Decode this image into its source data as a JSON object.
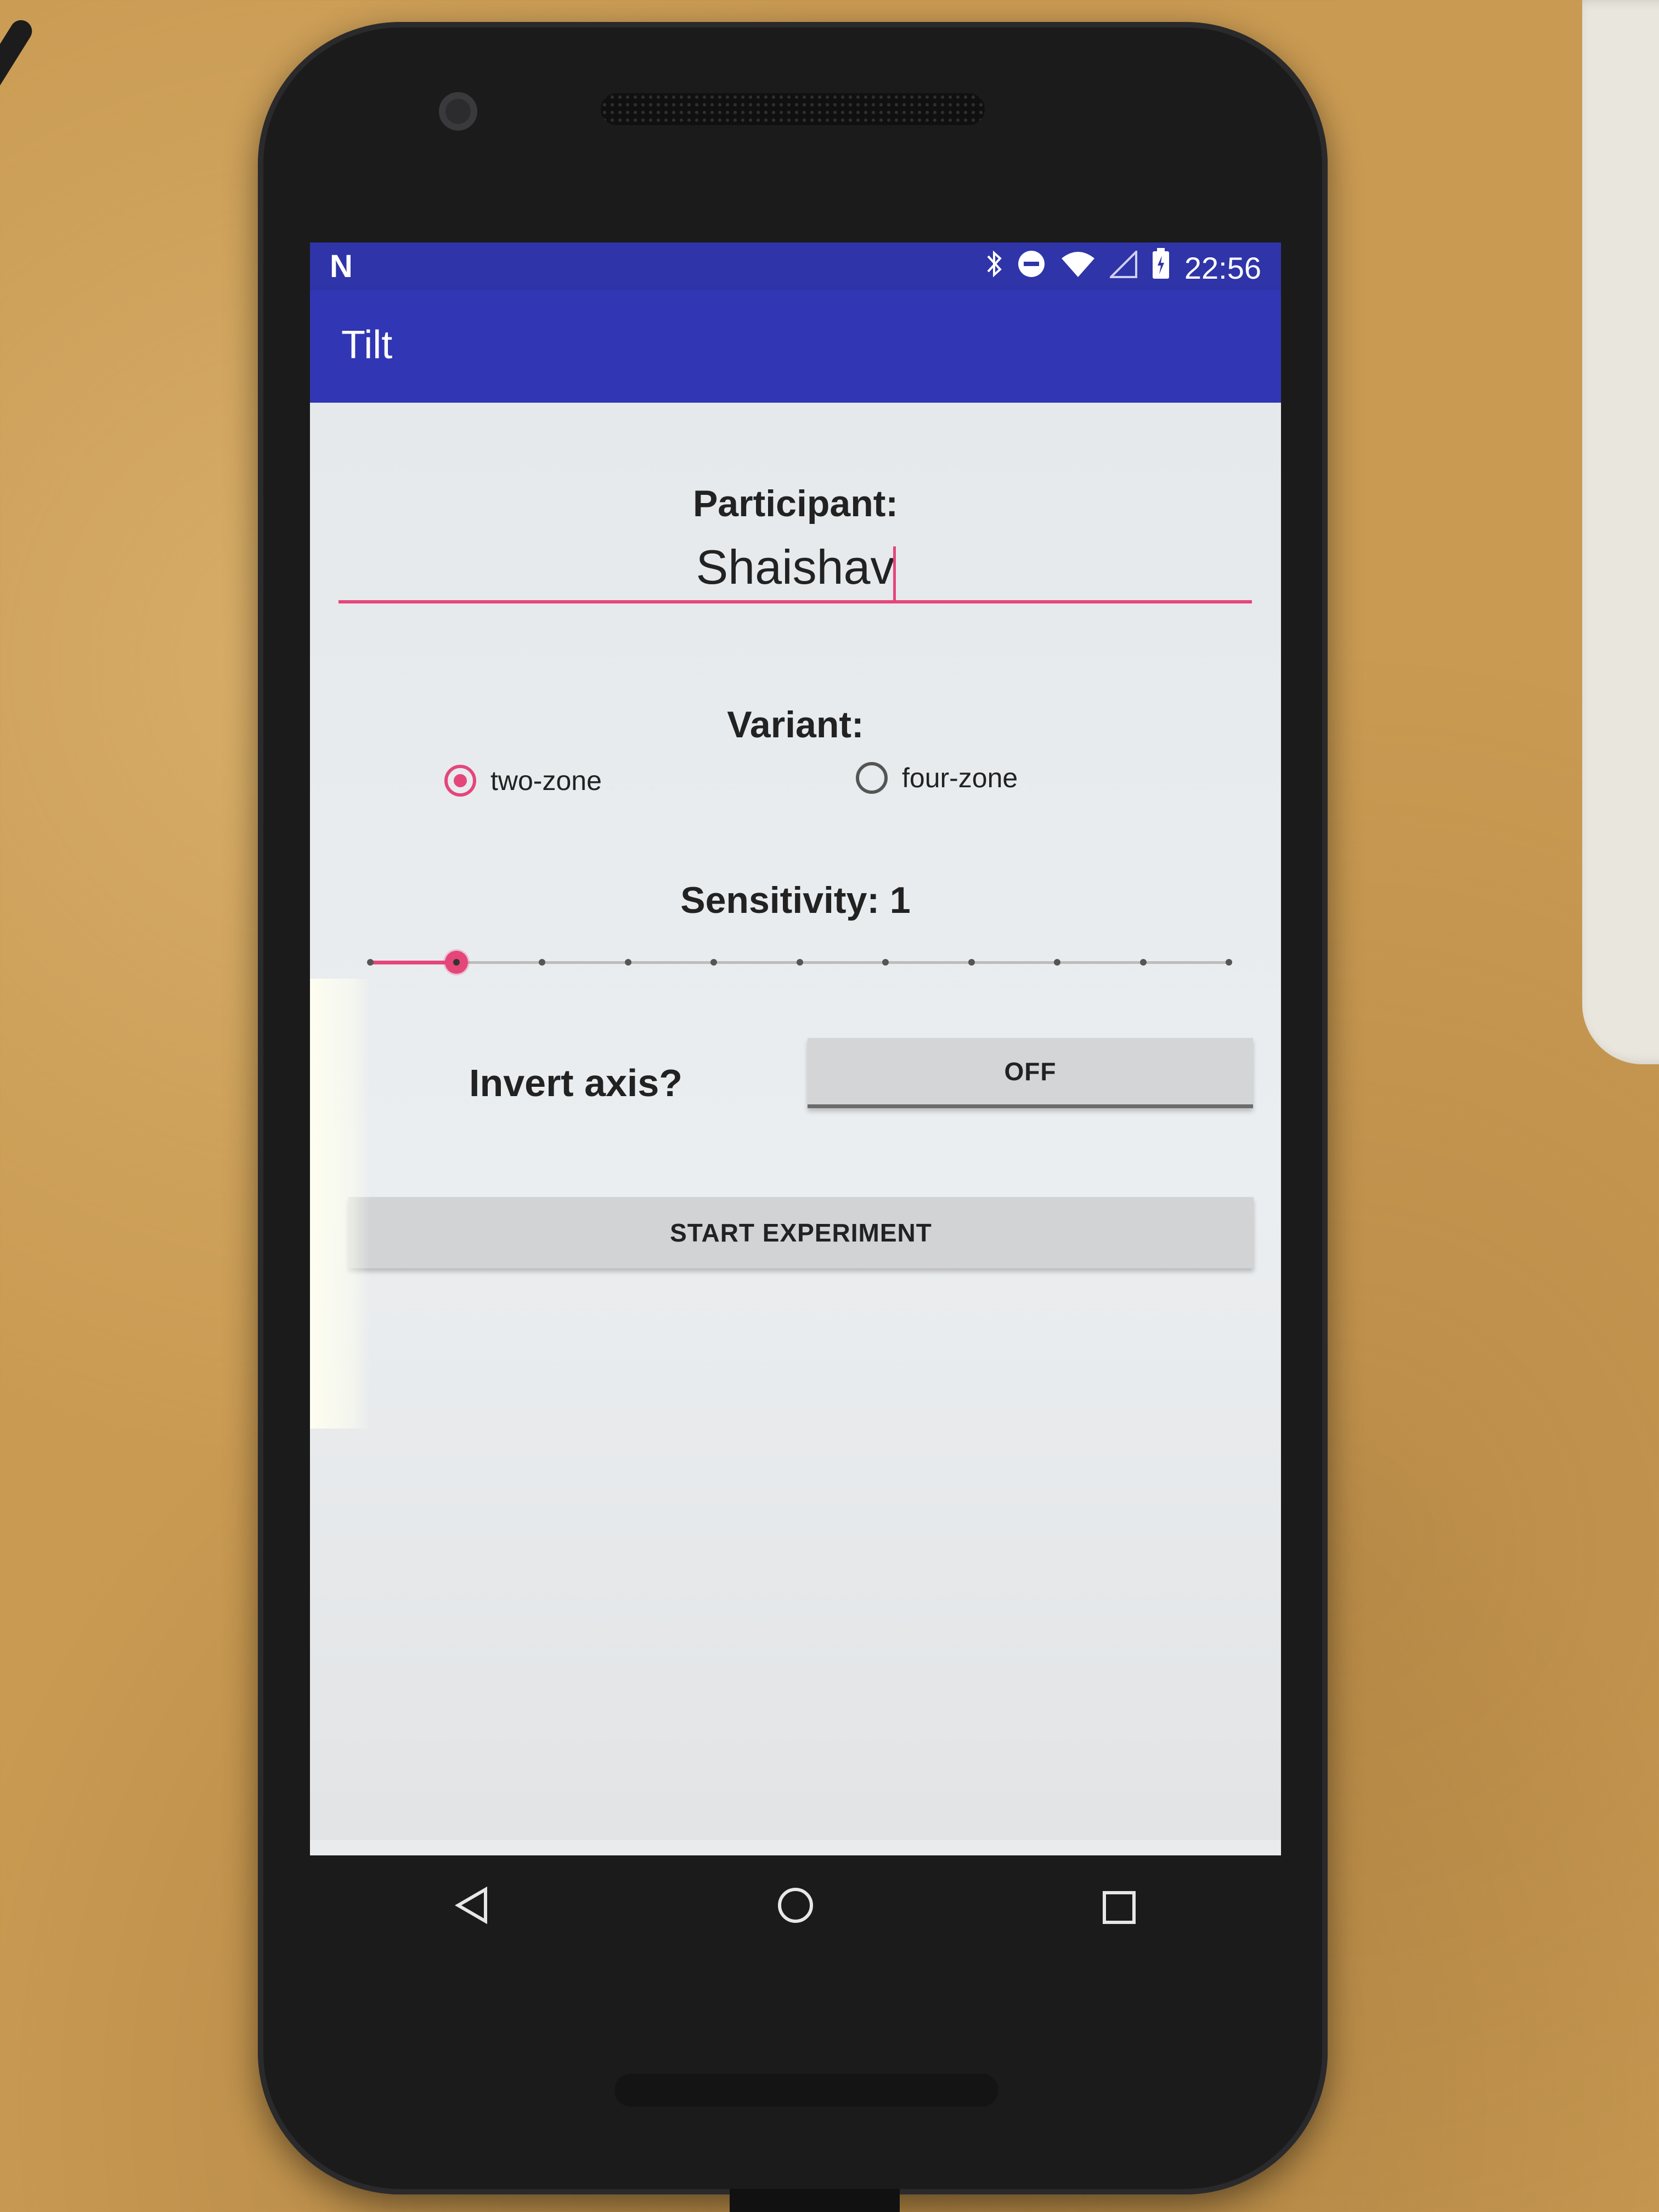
{
  "status_bar": {
    "notification_icon": "N",
    "icons": [
      "bluetooth-icon",
      "do-not-disturb-icon",
      "wifi-icon",
      "cell-signal-icon",
      "battery-icon"
    ],
    "time": "22:56"
  },
  "app_bar": {
    "title": "Tilt"
  },
  "form": {
    "participant_label": "Participant:",
    "participant_value": "Shaishav",
    "variant_label": "Variant:",
    "variant_options": [
      {
        "label": "two-zone",
        "selected": true
      },
      {
        "label": "four-zone",
        "selected": false
      }
    ],
    "sensitivity_label": "Sensitivity: 1",
    "sensitivity_value": 1,
    "sensitivity_steps": 11,
    "invert_label": "Invert axis?",
    "invert_toggle": "OFF",
    "start_button": "START EXPERIMENT"
  },
  "nav_bar": {
    "icons": [
      "back-icon",
      "home-icon",
      "recents-icon"
    ]
  },
  "colors": {
    "primary": "#3136b4",
    "primary_dark": "#2f34a8",
    "accent": "#e5467a"
  }
}
